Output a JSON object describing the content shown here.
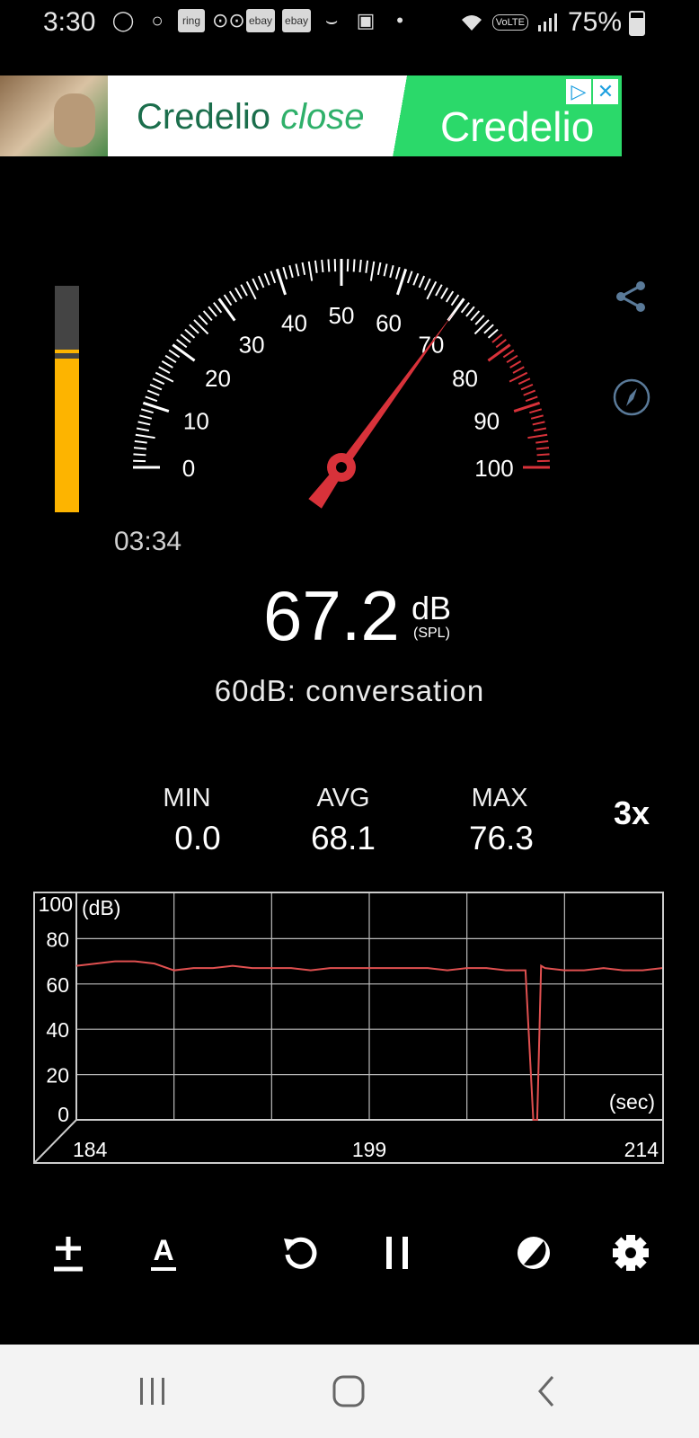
{
  "status_bar": {
    "time": "3:30",
    "notification_chips": [
      "ring",
      "ebay",
      "ebay"
    ],
    "battery": "75%",
    "network_label": "VoLTE"
  },
  "ad": {
    "left_brand": "Credelio",
    "left_word": "close",
    "right_brand": "Credelio",
    "colors": {
      "green": "#2bd96a",
      "text_green": "#1b6e4c"
    }
  },
  "meter": {
    "elapsed": "03:34",
    "reading": "67.2",
    "unit": "dB",
    "unit_sub": "(SPL)",
    "reference": "60dB: conversation",
    "needle_value": 70,
    "level_fraction": 0.68,
    "scale_labels": [
      "0",
      "10",
      "20",
      "30",
      "40",
      "50",
      "60",
      "70",
      "80",
      "90",
      "100"
    ],
    "colors": {
      "needle": "#d8323a",
      "level": "#fdb400",
      "red_zone": "#d8323a"
    }
  },
  "stats": {
    "min_label": "MIN",
    "min_value": "0.0",
    "avg_label": "AVG",
    "avg_value": "68.1",
    "max_label": "MAX",
    "max_value": "76.3",
    "speed": "3x"
  },
  "chart_data": {
    "type": "line",
    "ylabel": "(dB)",
    "xlabel": "(sec)",
    "ylim": [
      0,
      100
    ],
    "xlim": [
      184,
      214
    ],
    "y_ticks": [
      "100",
      "80",
      "60",
      "40",
      "20",
      "0"
    ],
    "x_ticks": [
      "184",
      "199",
      "214"
    ],
    "grid": true,
    "series": [
      {
        "color": "#e05050",
        "x": [
          184,
          185,
          186,
          187,
          188,
          189,
          190,
          191,
          192,
          193,
          194,
          195,
          196,
          197,
          198,
          199,
          200,
          201,
          202,
          203,
          204,
          205,
          206,
          207,
          207.4,
          207.6,
          207.8,
          208,
          209,
          210,
          211,
          212,
          213,
          214
        ],
        "values": [
          68,
          69,
          70,
          70,
          69,
          66,
          67,
          67,
          68,
          67,
          67,
          67,
          66,
          67,
          67,
          67,
          67,
          67,
          67,
          66,
          67,
          67,
          66,
          66,
          0,
          0,
          68,
          67,
          66,
          66,
          67,
          66,
          66,
          67
        ]
      }
    ]
  },
  "toolbar": {
    "icons": [
      "calibrate-icon",
      "weighting-icon",
      "reset-icon",
      "pause-icon",
      "theme-icon",
      "settings-icon"
    ]
  },
  "nav": {
    "icons": [
      "recents-icon",
      "home-icon",
      "back-icon"
    ]
  }
}
